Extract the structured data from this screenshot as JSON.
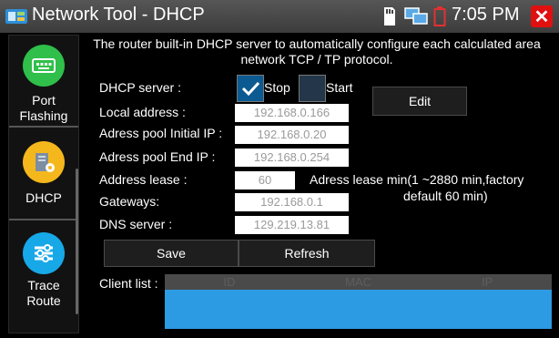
{
  "window": {
    "title": "Network Tool - DHCP",
    "time": "7:05 PM"
  },
  "sidebar": {
    "items": [
      {
        "label": "Port Flashing",
        "icon": "port-flashing-icon",
        "color": "#2fbf4a"
      },
      {
        "label": "DHCP",
        "icon": "dhcp-icon",
        "color": "#f5b81c"
      },
      {
        "label": "Trace Route",
        "icon": "trace-route-icon",
        "color": "#17a8e8"
      }
    ]
  },
  "main": {
    "intro": "The router built-in DHCP server to automatically configure each calculated area network TCP / TP protocol.",
    "dhcp_server_label": "DHCP server :",
    "stop_label": "Stop",
    "start_label": "Start",
    "stop_checked": true,
    "start_checked": false,
    "edit_label": "Edit",
    "local_address_label": "Local address :",
    "local_address": "192.168.0.166",
    "pool_initial_label": "Adress pool Initial IP :",
    "pool_initial": "192.168.0.20",
    "pool_end_label": "Adress pool End IP :",
    "pool_end": "192.168.0.254",
    "lease_label": "Address lease :",
    "lease": "60",
    "lease_hint_line1": "Adress lease min(1 ~2880 min,factory",
    "lease_hint_line2": "default 60 min)",
    "gateways_label": "Gateways:",
    "gateways": "192.168.0.1",
    "dns_label": "DNS server :",
    "dns": "129.219.13.81",
    "save_label": "Save",
    "refresh_label": "Refresh",
    "client_list_label": "Client list :",
    "client_columns": [
      "ID",
      "MAC",
      "IP"
    ]
  }
}
